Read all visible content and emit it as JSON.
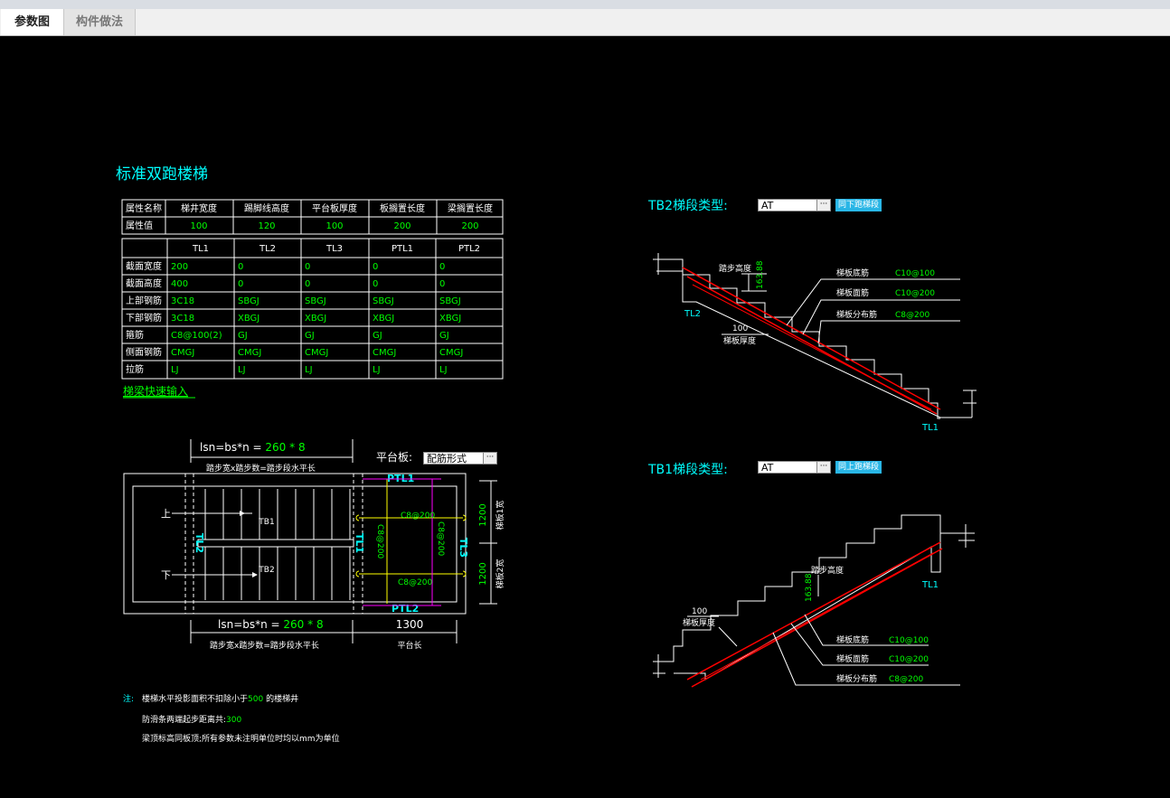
{
  "tabs": [
    {
      "label": "参数图"
    },
    {
      "label": "构件做法"
    }
  ],
  "title": "标准双跑楼梯",
  "props_table": {
    "row_headers": [
      "属性名称",
      "属性值"
    ],
    "headers": [
      "梯井宽度",
      "踢脚线高度",
      "平台板厚度",
      "板搁置长度",
      "梁搁置长度"
    ],
    "values": [
      "100",
      "120",
      "100",
      "200",
      "200"
    ]
  },
  "beam_table": {
    "columns": [
      "TL1",
      "TL2",
      "TL3",
      "PTL1",
      "PTL2"
    ],
    "rows": [
      {
        "label": "截面宽度",
        "values": [
          "200",
          "0",
          "0",
          "0",
          "0"
        ]
      },
      {
        "label": "截面高度",
        "values": [
          "400",
          "0",
          "0",
          "0",
          "0"
        ]
      },
      {
        "label": "上部钢筋",
        "values": [
          "3C18",
          "SBGJ",
          "SBGJ",
          "SBGJ",
          "SBGJ"
        ]
      },
      {
        "label": "下部钢筋",
        "values": [
          "3C18",
          "XBGJ",
          "XBGJ",
          "XBGJ",
          "XBGJ"
        ]
      },
      {
        "label": "箍筋",
        "values": [
          "C8@100(2)",
          "GJ",
          "GJ",
          "GJ",
          "GJ"
        ]
      },
      {
        "label": "侧面钢筋",
        "values": [
          "CMGJ",
          "CMGJ",
          "CMGJ",
          "CMGJ",
          "CMGJ"
        ]
      },
      {
        "label": "拉筋",
        "values": [
          "LJ",
          "LJ",
          "LJ",
          "LJ",
          "LJ"
        ]
      }
    ]
  },
  "quick_input_link": "梯梁快速输入",
  "plan": {
    "top_formula_prefix": "lsn=bs*n = ",
    "top_formula_value": "260 * 8",
    "top_caption": "踏步宽x踏步数=踏步段水平长",
    "platform_label": "平台板:",
    "platform_value": "配筋形式",
    "bottom_formula_prefix": "lsn=bs*n = ",
    "bottom_formula_value": "260 * 8",
    "bottom_caption": "踏步宽x踏步数=踏步段水平长",
    "platform_length": "1300",
    "platform_length_caption": "平台长",
    "up_label": "上",
    "down_label": "下",
    "tb1": "TB1",
    "tb2": "TB2",
    "tl1": "TL1",
    "tl2": "TL2",
    "tl3": "TL3",
    "ptl1": "PTL1",
    "ptl2": "PTL2",
    "rebar_top": "C8@200",
    "rebar_bottom": "C8@200",
    "rebar_left_v": "C8@200",
    "rebar_right_v": "C8@200",
    "width1": "1200",
    "width1_caption": "梯板1宽",
    "width2": "1200",
    "width2_caption": "梯板2宽"
  },
  "notes": {
    "prefix": "注:",
    "line1_a": "楼梯水平投影面积不扣除小于",
    "line1_val": "500",
    "line1_b": " 的楼梯井",
    "line2_a": "防滑条两端起步距离共:",
    "line2_val": "300",
    "line3": "梁顶标高同板顶;所有参数未注明单位时均以mm为单位"
  },
  "tb2": {
    "label": "TB2梯段类型:",
    "type_value": "AT",
    "ellipsis": "···",
    "button": "同下跑梯段",
    "step_height_label": "踏步高度",
    "step_height_value": "163.88",
    "bottom_rebar_label": "梯板底筋",
    "bottom_rebar_value": "C10@100",
    "top_rebar_label": "梯板面筋",
    "top_rebar_value": "C10@200",
    "dist_rebar_label": "梯板分布筋",
    "dist_rebar_value": "C8@200",
    "thickness_value": "100",
    "thickness_label": "梯板厚度",
    "tl_left": "TL2",
    "tl_right": "TL1"
  },
  "tb1": {
    "label": "TB1梯段类型:",
    "type_value": "AT",
    "ellipsis": "···",
    "button": "同上跑梯段",
    "step_height_label": "踏步高度",
    "step_height_value": "163.88",
    "bottom_rebar_label": "梯板底筋",
    "bottom_rebar_value": "C10@100",
    "top_rebar_label": "梯板面筋",
    "top_rebar_value": "C10@200",
    "dist_rebar_label": "梯板分布筋",
    "dist_rebar_value": "C8@200",
    "thickness_value": "100",
    "thickness_label": "梯板厚度",
    "tl_right": "TL1"
  },
  "colors": {
    "cyan": "#00ffff",
    "green": "#00ff00",
    "red": "#ff0000",
    "yellow": "#ffff00",
    "magenta": "#ff00ff",
    "button_blue": "#29b6e6"
  }
}
